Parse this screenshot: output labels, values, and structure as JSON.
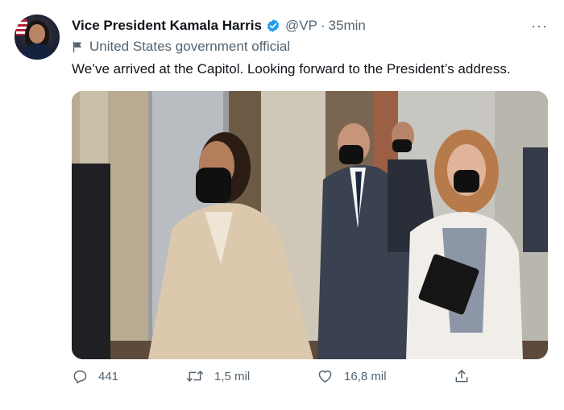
{
  "tweet": {
    "author": {
      "name": "Vice President Kamala Harris",
      "handle": "@VP",
      "separator": "·",
      "time": "35min"
    },
    "label": "United States government official",
    "text": "We’ve arrived at the Capitol. Looking forward to the President’s address.",
    "more": "···",
    "media": {
      "icon": "photo"
    },
    "actions": {
      "reply_count": "441",
      "retweet_count": "1,5 mil",
      "like_count": "16,8 mil"
    }
  },
  "colors": {
    "primary_text": "#0f1419",
    "secondary_text": "#536471",
    "verified": "#1d9bf0",
    "background": "#ffffff"
  }
}
